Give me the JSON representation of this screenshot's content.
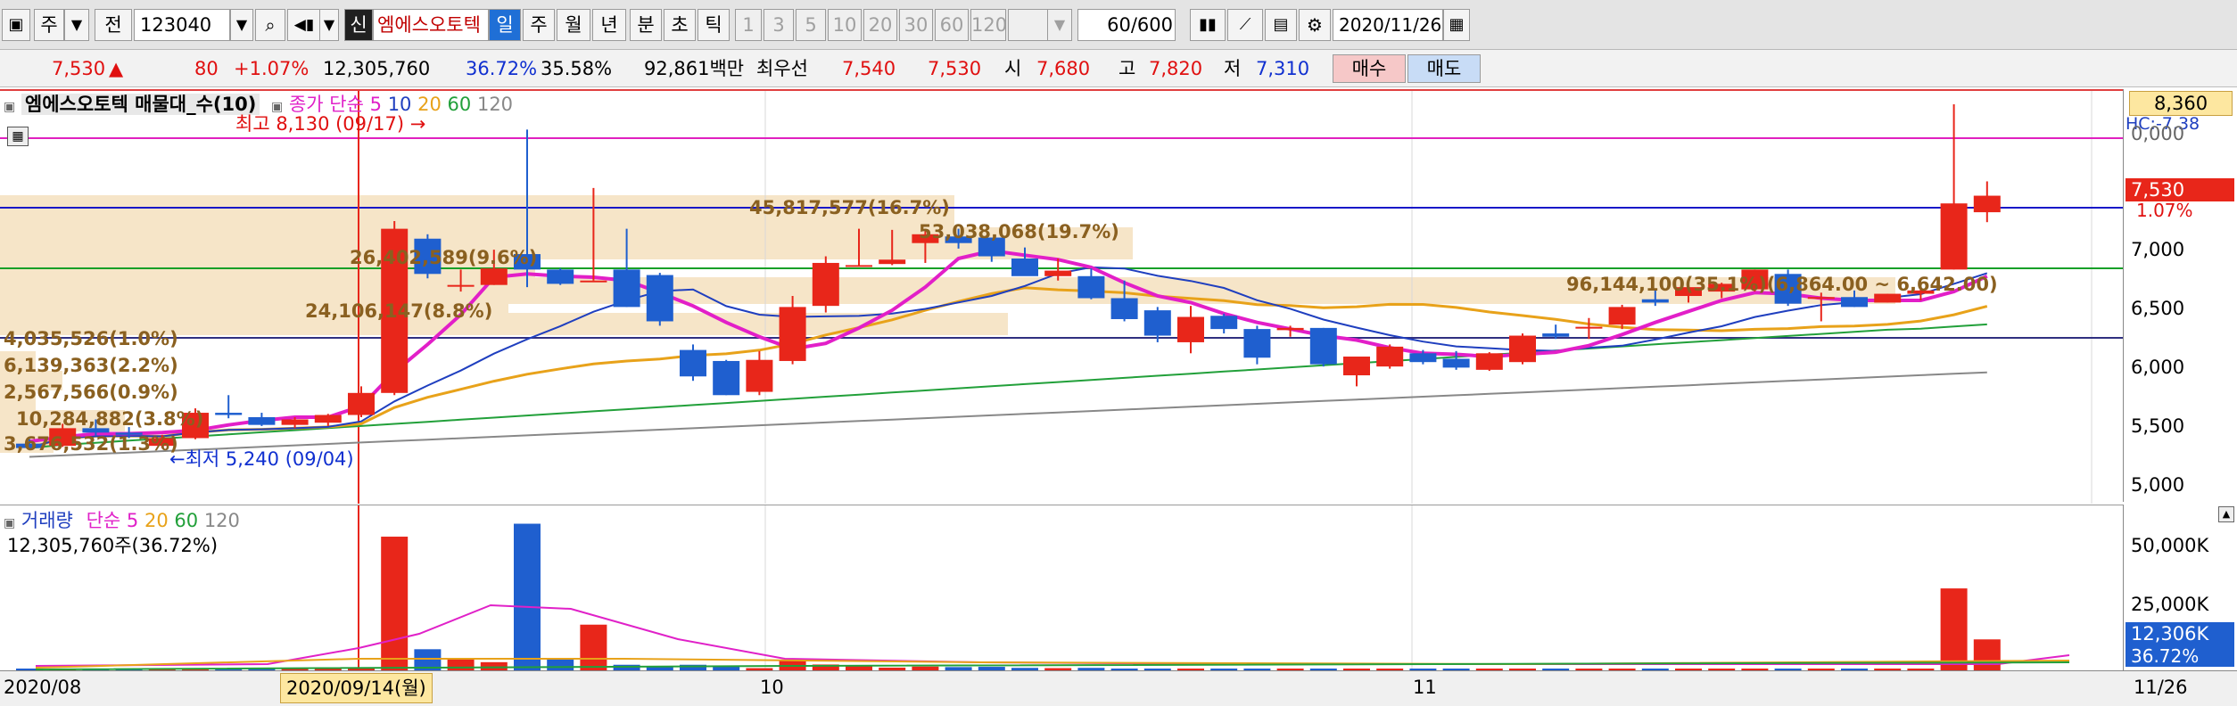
{
  "toolbar": {
    "type_label": "주",
    "market_label": "전",
    "code": "123040",
    "badge": "신",
    "stock_name": "엠에스오토텍",
    "periods": [
      "일",
      "주",
      "월",
      "년",
      "분",
      "초",
      "틱"
    ],
    "active_period": "일",
    "intervals": [
      "1",
      "3",
      "5",
      "10",
      "20",
      "30",
      "60",
      "120"
    ],
    "count": "60",
    "count_total": "/600",
    "date": "2020/11/26"
  },
  "quote": {
    "price": "7,530",
    "change": "80",
    "change_pct": "+1.07%",
    "volume": "12,305,760",
    "rate1": "36.72%",
    "rate2": "35.58%",
    "amount": "92,861백만",
    "best_label": "최우선",
    "best_ask": "7,540",
    "best_bid": "7,530",
    "open_label": "시",
    "open": "7,680",
    "high_label": "고",
    "high": "7,820",
    "low_label": "저",
    "low": "7,310",
    "buy_label": "매수",
    "sell_label": "매도"
  },
  "price_pane": {
    "title": "엠에스오토텍 매물대_수(10)",
    "ma_label": "종가 단순",
    "ma_periods": [
      "5",
      "10",
      "20",
      "60",
      "120"
    ],
    "high_note": "최고 8,130 (09/17) →",
    "low_note": "←최저 5,240 (09/04)",
    "ticks": [
      "7,000",
      "6,500",
      "6,000",
      "5,500",
      "5,000"
    ],
    "top_badge": "8,360",
    "hc_label": "HC:-7.38",
    "tick_cut": "0,000",
    "current_badge": "7,530",
    "current_pct": "1.07%"
  },
  "volume_profile": [
    "45,817,577(16.7%)",
    "53,038,068(19.7%)",
    "26,402,589(9.6%)",
    "24,106,147(8.8%)",
    "96,144,100(35.1%)(6,864.00 ~ 6,642.00)",
    "4,035,526(1.0%)",
    "6,139,363(2.2%)",
    "2,567,566(0.9%)",
    "10,284,882(3.8%)",
    "3,676,532(1.3%)"
  ],
  "volume_pane": {
    "title": "거래량",
    "ma_label": "단순",
    "ma_periods": [
      "5",
      "20",
      "60",
      "120"
    ],
    "current": "12,305,760주(36.72%)",
    "ticks": [
      "50,000K",
      "25,000K"
    ],
    "current_badge": "12,306K",
    "current_pct": "36.72%"
  },
  "x_axis": {
    "labels": [
      "2020/08",
      "10",
      "11",
      "11/26"
    ],
    "cursor": "2020/09/14(월)"
  },
  "colors": {
    "up": "#e8261a",
    "down": "#1f5fcf",
    "ma5": "#e21fc8",
    "ma10": "#1f3fbf",
    "ma20": "#e8a21a",
    "ma60": "#22a03a",
    "ma120": "#888888",
    "profile": "#f6e5c8"
  },
  "chart_data": {
    "type": "candlestick",
    "x": [
      "2020/08",
      "10",
      "11",
      "11/26"
    ],
    "price_ylim": [
      4800,
      8400
    ],
    "ohlc": [
      [
        5280,
        5320,
        5220,
        5240
      ],
      [
        5260,
        5460,
        5250,
        5420
      ],
      [
        5420,
        5500,
        5350,
        5380
      ],
      [
        5380,
        5430,
        5330,
        5360
      ],
      [
        5260,
        5360,
        5240,
        5330
      ],
      [
        5330,
        5600,
        5320,
        5560
      ],
      [
        5560,
        5720,
        5510,
        5540
      ],
      [
        5520,
        5560,
        5440,
        5450
      ],
      [
        5450,
        5520,
        5420,
        5500
      ],
      [
        5470,
        5550,
        5440,
        5540
      ],
      [
        5540,
        5800,
        5520,
        5740
      ],
      [
        5740,
        7300,
        5720,
        7230
      ],
      [
        7140,
        7180,
        6780,
        6820
      ],
      [
        6720,
        6860,
        6660,
        6720
      ],
      [
        6720,
        7040,
        6720,
        6870
      ],
      [
        7000,
        8130,
        6700,
        6860
      ],
      [
        6860,
        6870,
        6720,
        6730
      ],
      [
        6750,
        7600,
        6760,
        6760
      ],
      [
        6860,
        7230,
        6520,
        6520
      ],
      [
        6810,
        6830,
        6350,
        6390
      ],
      [
        6130,
        6180,
        5850,
        5890
      ],
      [
        6030,
        6040,
        5720,
        5720
      ],
      [
        5750,
        6120,
        5720,
        6040
      ],
      [
        6030,
        6620,
        6000,
        6520
      ],
      [
        6530,
        6980,
        6470,
        6920
      ],
      [
        6900,
        7230,
        6890,
        6900
      ],
      [
        6910,
        7220,
        6900,
        6950
      ],
      [
        7100,
        7210,
        6920,
        7180
      ],
      [
        7160,
        7230,
        7050,
        7100
      ],
      [
        7150,
        7150,
        6930,
        6980
      ],
      [
        6960,
        7060,
        6810,
        6800
      ],
      [
        6800,
        6960,
        6760,
        6850
      ],
      [
        6800,
        6870,
        6590,
        6600
      ],
      [
        6600,
        6760,
        6390,
        6410
      ],
      [
        6490,
        6520,
        6200,
        6260
      ],
      [
        6200,
        6530,
        6100,
        6430
      ],
      [
        6440,
        6460,
        6280,
        6320
      ],
      [
        6320,
        6350,
        6000,
        6060
      ],
      [
        6310,
        6350,
        6250,
        6330
      ],
      [
        6330,
        6330,
        5980,
        6000
      ],
      [
        5900,
        6040,
        5800,
        6070
      ],
      [
        5980,
        6180,
        5960,
        6160
      ],
      [
        6100,
        6130,
        6000,
        6020
      ],
      [
        6050,
        6120,
        5950,
        5970
      ],
      [
        5950,
        6110,
        5940,
        6100
      ],
      [
        6020,
        6280,
        6000,
        6260
      ],
      [
        6280,
        6360,
        6230,
        6250
      ],
      [
        6330,
        6420,
        6230,
        6340
      ],
      [
        6360,
        6540,
        6320,
        6520
      ],
      [
        6590,
        6680,
        6530,
        6560
      ],
      [
        6620,
        6700,
        6560,
        6700
      ],
      [
        6660,
        6740,
        6600,
        6730
      ],
      [
        6680,
        6860,
        6660,
        6860
      ],
      [
        6820,
        6860,
        6530,
        6550
      ],
      [
        6600,
        6650,
        6390,
        6610
      ],
      [
        6610,
        6670,
        6520,
        6520
      ],
      [
        6560,
        6640,
        6560,
        6640
      ],
      [
        6640,
        6700,
        6580,
        6670
      ],
      [
        6860,
        8360,
        6860,
        7460
      ],
      [
        7380,
        7660,
        7290,
        7530
      ]
    ],
    "ma5_points": [
      5300,
      5340,
      5370,
      5370,
      5380,
      5400,
      5450,
      5490,
      5520,
      5520,
      5620,
      5930,
      6180,
      6450,
      6790,
      6820,
      6800,
      6790,
      6760,
      6650,
      6530,
      6380,
      6250,
      6140,
      6190,
      6330,
      6490,
      6700,
      6960,
      7030,
      6990,
      6950,
      6880,
      6740,
      6620,
      6560,
      6460,
      6380,
      6320,
      6260,
      6220,
      6150,
      6100,
      6090,
      6070,
      6090,
      6110,
      6170,
      6270,
      6380,
      6480,
      6580,
      6650,
      6640,
      6600,
      6580,
      6580,
      6580,
      6660,
      6800
    ],
    "volume_ylim": [
      0,
      62000
    ],
    "volume": [
      900,
      700,
      600,
      500,
      800,
      1100,
      1200,
      600,
      500,
      700,
      1500,
      52000,
      8500,
      4800,
      3500,
      57000,
      4600,
      18000,
      2500,
      2000,
      2500,
      1800,
      1200,
      4200,
      2600,
      2200,
      1400,
      1800,
      1600,
      1700,
      1300,
      1200,
      1300,
      900,
      1000,
      900,
      800,
      700,
      900,
      800,
      700,
      800,
      700,
      600,
      800,
      900,
      800,
      700,
      900,
      700,
      800,
      900,
      1000,
      800,
      700,
      800,
      700,
      900,
      32000,
      12306
    ]
  }
}
